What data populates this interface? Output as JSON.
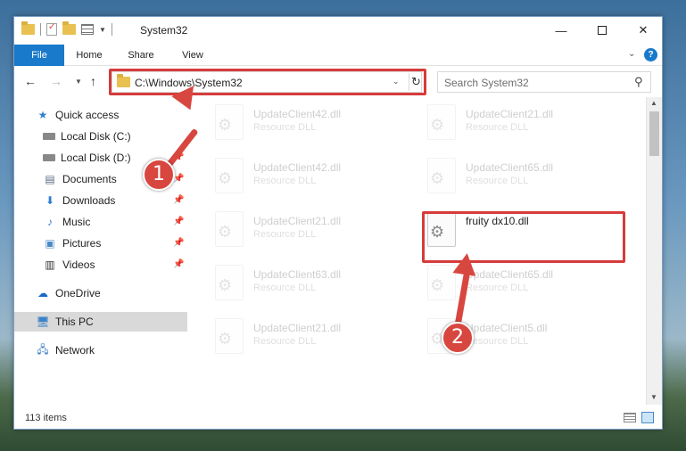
{
  "window": {
    "title": "System32",
    "controls": {
      "minimize": "—",
      "maximize": "",
      "close": "✕"
    }
  },
  "ribbon": {
    "tabs": [
      "File",
      "Home",
      "Share",
      "View"
    ],
    "help": "?"
  },
  "nav": {
    "address": "C:\\Windows\\System32",
    "search_placeholder": "Search System32"
  },
  "sidebar": {
    "items": [
      {
        "label": "Quick access",
        "icon": "star-icon",
        "pinned": false
      },
      {
        "label": "Local Disk (C:)",
        "icon": "disk-icon",
        "pinned": false
      },
      {
        "label": "Local Disk (D:)",
        "icon": "disk-icon",
        "pinned": true
      },
      {
        "label": "Documents",
        "icon": "documents-icon",
        "pinned": true
      },
      {
        "label": "Downloads",
        "icon": "downloads-icon",
        "pinned": true
      },
      {
        "label": "Music",
        "icon": "music-icon",
        "pinned": true
      },
      {
        "label": "Pictures",
        "icon": "pictures-icon",
        "pinned": true
      },
      {
        "label": "Videos",
        "icon": "videos-icon",
        "pinned": true
      },
      {
        "label": "OneDrive",
        "icon": "onedrive-icon",
        "pinned": false
      },
      {
        "label": "This PC",
        "icon": "this-pc-icon",
        "pinned": false,
        "selected": true
      },
      {
        "label": "Network",
        "icon": "network-icon",
        "pinned": false
      }
    ]
  },
  "files": [
    {
      "name": "UpdateClient42.dll",
      "type": "Resource DLL"
    },
    {
      "name": "UpdateClient21.dll",
      "type": "Resource DLL"
    },
    {
      "name": "UpdateClient42.dll",
      "type": "Resource DLL"
    },
    {
      "name": "UpdateClient65.dll",
      "type": "Resource DLL"
    },
    {
      "name": "UpdateClient21.dll",
      "type": "Resource DLL"
    },
    {
      "name": "fruity dx10.dll",
      "type": ""
    },
    {
      "name": "UpdateClient63.dll",
      "type": "Resource DLL"
    },
    {
      "name": "UpdateClient65.dll",
      "type": "Resource DLL"
    },
    {
      "name": "UpdateClient21.dll",
      "type": "Resource DLL"
    },
    {
      "name": "UpdateClient5.dll",
      "type": "Resource DLL"
    }
  ],
  "status": {
    "count": "113 items"
  },
  "annotations": {
    "marker1": "1",
    "marker2": "2",
    "color": "#d63b3b"
  }
}
